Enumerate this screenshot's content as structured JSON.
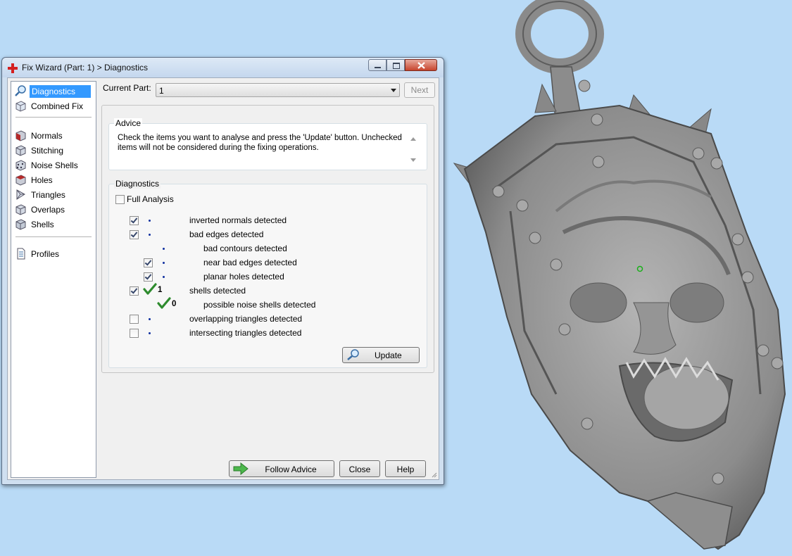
{
  "window": {
    "title": "Fix Wizard (Part: 1) > Diagnostics"
  },
  "sidebar": {
    "items": [
      {
        "label": "Diagnostics",
        "icon": "magnifier-icon",
        "selected": true
      },
      {
        "label": "Combined Fix",
        "icon": "cube-icon"
      },
      {
        "label": "Normals",
        "icon": "normals-cube-icon"
      },
      {
        "label": "Stitching",
        "icon": "stitching-cube-icon"
      },
      {
        "label": "Noise Shells",
        "icon": "noise-shells-icon"
      },
      {
        "label": "Holes",
        "icon": "holes-cube-icon"
      },
      {
        "label": "Triangles",
        "icon": "triangles-icon"
      },
      {
        "label": "Overlaps",
        "icon": "overlaps-cube-icon"
      },
      {
        "label": "Shells",
        "icon": "shells-cube-icon"
      },
      {
        "label": "Profiles",
        "icon": "document-icon"
      }
    ]
  },
  "current_part": {
    "label": "Current Part:",
    "value": "1",
    "next_label": "Next"
  },
  "advice": {
    "title": "Advice",
    "text": "Check the items you want to analyse and press the 'Update' button. Unchecked items will not be considered during the fixing operations."
  },
  "diagnostics": {
    "title": "Diagnostics",
    "full_analysis_label": "Full Analysis",
    "full_analysis_checked": false,
    "rows": [
      {
        "label": "inverted normals detected",
        "checked": true,
        "status": "dot"
      },
      {
        "label": "bad edges detected",
        "checked": true,
        "status": "dot"
      },
      {
        "label": "bad contours detected",
        "status": "dot"
      },
      {
        "label": "near bad edges detected",
        "checked": true,
        "status": "dot"
      },
      {
        "label": "planar holes detected",
        "checked": true,
        "status": "dot"
      },
      {
        "label": "shells detected",
        "checked": true,
        "status": "check",
        "count": "1"
      },
      {
        "label": "possible noise shells detected",
        "status": "check",
        "count": "0"
      },
      {
        "label": "overlapping triangles detected",
        "checked": false,
        "status": "dot"
      },
      {
        "label": "intersecting triangles detected",
        "checked": false,
        "status": "dot"
      }
    ],
    "update_label": "Update"
  },
  "footer": {
    "follow_advice_label": "Follow Advice",
    "close_label": "Close",
    "help_label": "Help"
  },
  "colors": {
    "desktop_bg": "#b9daf6",
    "selection": "#3399ff",
    "check_green": "#2e8b2e",
    "model_gray": "#8a8a8a"
  }
}
